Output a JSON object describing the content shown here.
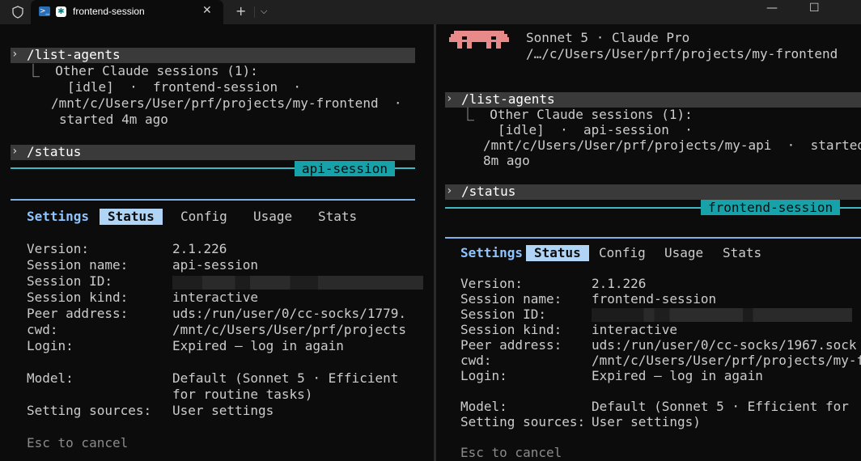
{
  "window": {
    "tab_title": "frontend-session",
    "new_tab_glyph": "+",
    "dropdown_glyph": "⌵",
    "close_glyph": "✕",
    "minimize_glyph": "—",
    "maximize_glyph": "☐",
    "window_close_glyph": "✕",
    "tab_icons": [
      "powershell-icon",
      "claude-star-icon"
    ]
  },
  "left": {
    "cmd1": "/list-agents",
    "agents_header": "⎿  Other Claude sessions (1):",
    "agent_line1": "[idle]  ·  frontend-session  ·",
    "agent_line2": "/mnt/c/Users/User/prf/projects/my-frontend  ·",
    "agent_line3": "started 4m ago",
    "cmd2": "/status",
    "session_tag": "api-session",
    "tabs": {
      "settings": "Settings",
      "status": "Status",
      "config": "Config",
      "usage": "Usage",
      "stats": "Stats"
    },
    "rows": {
      "version_label": "Version:",
      "version": "2.1.226",
      "session_name_label": "Session name:",
      "session_name": "api-session",
      "session_id_label": "Session ID:",
      "session_kind_label": "Session kind:",
      "session_kind": "interactive",
      "peer_label": "Peer address:",
      "peer": "uds:/run/user/0/cc-socks/1779.",
      "cwd_label": "cwd:",
      "cwd": "/mnt/c/Users/User/prf/projects",
      "login_label": "Login:",
      "login": "Expired – log in again",
      "model_label": "Model:",
      "model1": "Default (Sonnet 5 · Efficient",
      "model2": "for routine tasks)",
      "sources_label": "Setting sources:",
      "sources": "User settings"
    },
    "esc": "Esc to cancel"
  },
  "right": {
    "header_line1": "Sonnet 5 · Claude Pro",
    "header_line2": "/…/c/Users/User/prf/projects/my-frontend",
    "cmd1": "/list-agents",
    "agents_header": "⎿  Other Claude sessions (1):",
    "agent_line1": "[idle]  ·  api-session  ·",
    "agent_line2": "/mnt/c/Users/User/prf/projects/my-api  ·  started",
    "agent_line3": "8m ago",
    "cmd2": "/status",
    "session_tag": "frontend-session",
    "tabs": {
      "settings": "Settings",
      "status": "Status",
      "config": "Config",
      "usage": "Usage",
      "stats": "Stats"
    },
    "rows": {
      "version_label": "Version:",
      "version": "2.1.226",
      "session_name_label": "Session name:",
      "session_name": "frontend-session",
      "session_id_label": "Session ID:",
      "session_kind_label": "Session kind:",
      "session_kind": "interactive",
      "peer_label": "Peer address:",
      "peer": "uds:/run/user/0/cc-socks/1967.sock",
      "cwd_label": "cwd:",
      "cwd": "/mnt/c/Users/User/prf/projects/my-f",
      "login_label": "Login:",
      "login": "Expired – log in again",
      "model_label": "Model:",
      "model1": "Default (Sonnet 5 · Efficient for",
      "sources_label": "Setting sources:",
      "sources": "User settings)"
    },
    "esc": "Esc to cancel"
  },
  "colors": {
    "bg": "#0c0c0c",
    "cyan_rule": "#3fb8c2",
    "teal_tag": "#17a2a9",
    "tab_blue": "#8ec5ff",
    "active_tab_bg": "#b0d4f5",
    "mascot": "#e88a8a"
  }
}
